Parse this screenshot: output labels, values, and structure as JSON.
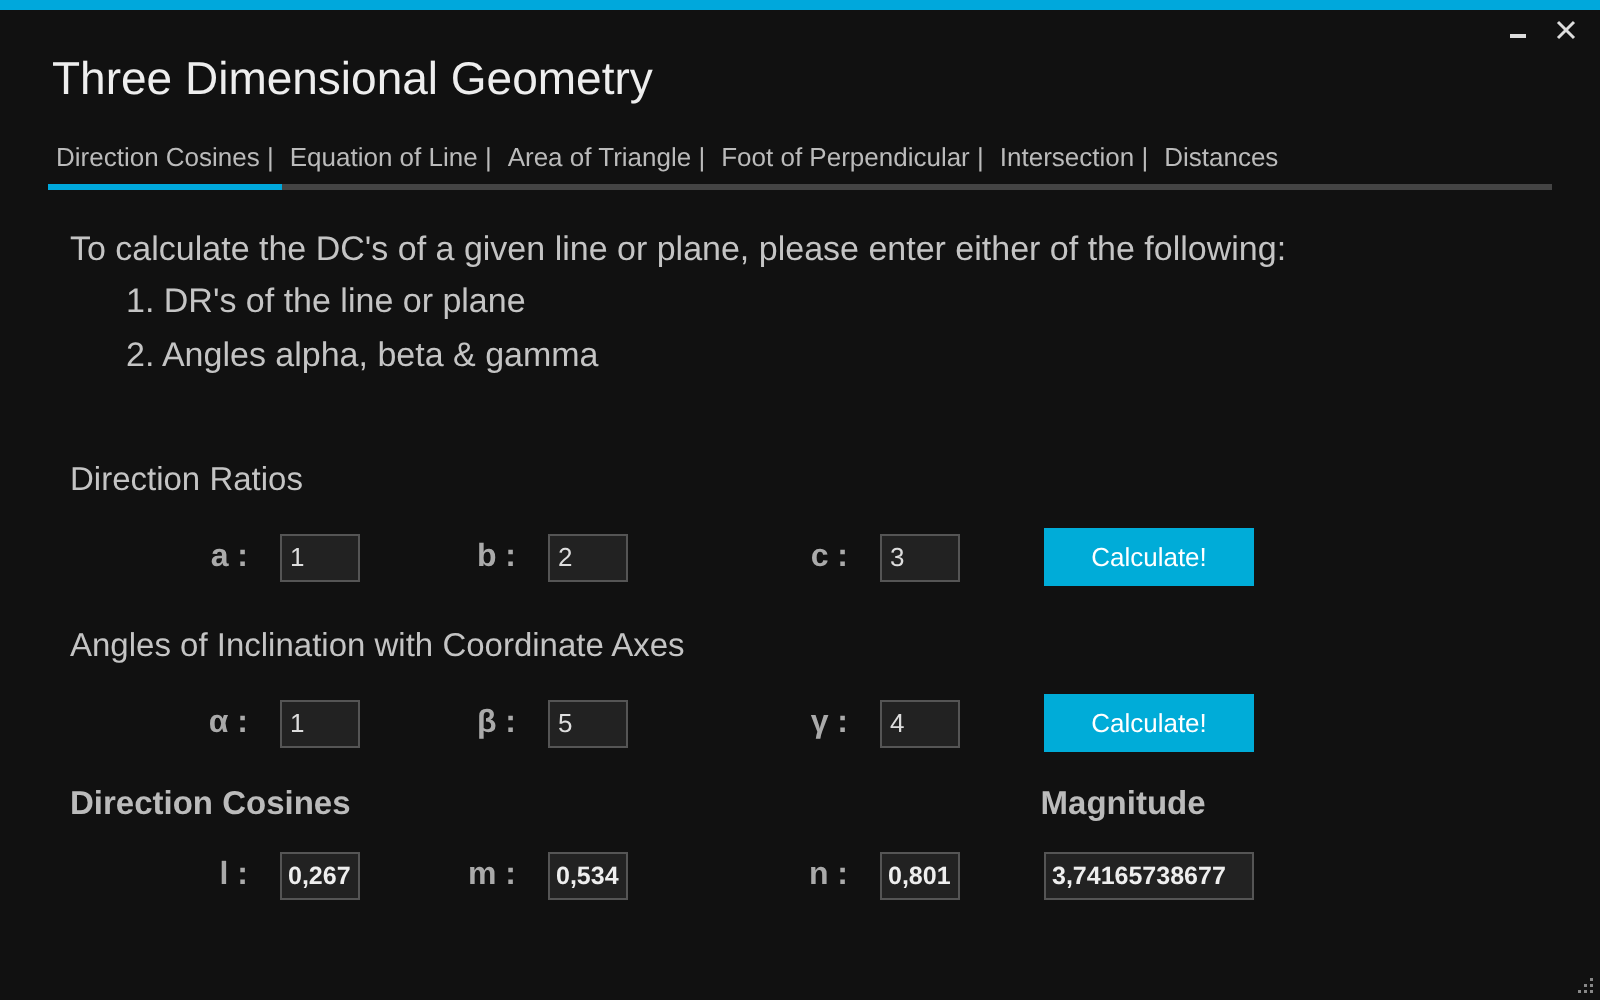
{
  "window": {
    "title": "Three Dimensional Geometry"
  },
  "tabs": [
    {
      "label": "Direction Cosines |",
      "selected": true
    },
    {
      "label": "Equation of Line |",
      "selected": false
    },
    {
      "label": "Area of Triangle |",
      "selected": false
    },
    {
      "label": "Foot of Perpendicular |",
      "selected": false
    },
    {
      "label": "Intersection |",
      "selected": false
    },
    {
      "label": "Distances",
      "selected": false
    }
  ],
  "intro": {
    "text": "To calculate the DC's of a given line or plane, please enter either of the following:",
    "items": [
      "1. DR's of the line or plane",
      "2. Angles alpha, beta & gamma"
    ]
  },
  "sections": [
    {
      "heading": "Direction Ratios",
      "fields": [
        {
          "label": "a :",
          "value": "1"
        },
        {
          "label": "b :",
          "value": "2"
        },
        {
          "label": "c :",
          "value": "3"
        }
      ],
      "button": "Calculate!"
    },
    {
      "heading": "Angles of Inclination with Coordinate Axes",
      "fields": [
        {
          "label": "α :",
          "value": "1"
        },
        {
          "label": "β :",
          "value": "5"
        },
        {
          "label": "γ :",
          "value": "4"
        }
      ],
      "button": "Calculate!"
    }
  ],
  "results": {
    "heading": "Direction Cosines",
    "magnitude_heading": "Magnitude",
    "fields": [
      {
        "label": "l :",
        "value": "0,267"
      },
      {
        "label": "m :",
        "value": "0,534"
      },
      {
        "label": "n :",
        "value": "0,801"
      }
    ],
    "magnitude": "3,74165738677"
  }
}
